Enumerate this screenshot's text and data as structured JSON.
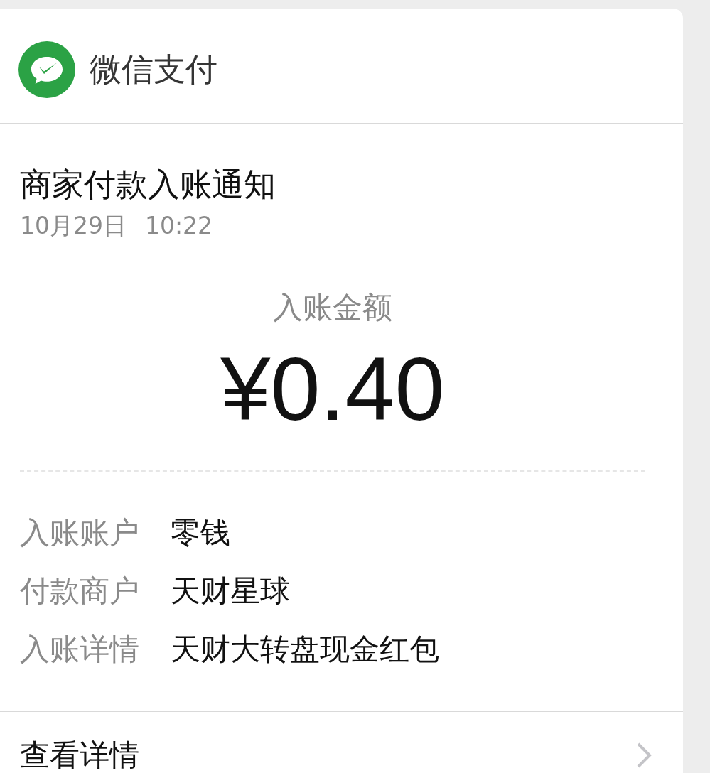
{
  "header": {
    "title": "微信支付"
  },
  "notice": {
    "title": "商家付款入账通知",
    "date": "10月29日",
    "time": "10:22"
  },
  "amount": {
    "label": "入账金额",
    "value": "¥0.40"
  },
  "details": [
    {
      "label": "入账账户",
      "value": "零钱"
    },
    {
      "label": "付款商户",
      "value": "天财星球"
    },
    {
      "label": "入账详情",
      "value": "天财大转盘现金红包"
    }
  ],
  "footer": {
    "link": "查看详情"
  }
}
